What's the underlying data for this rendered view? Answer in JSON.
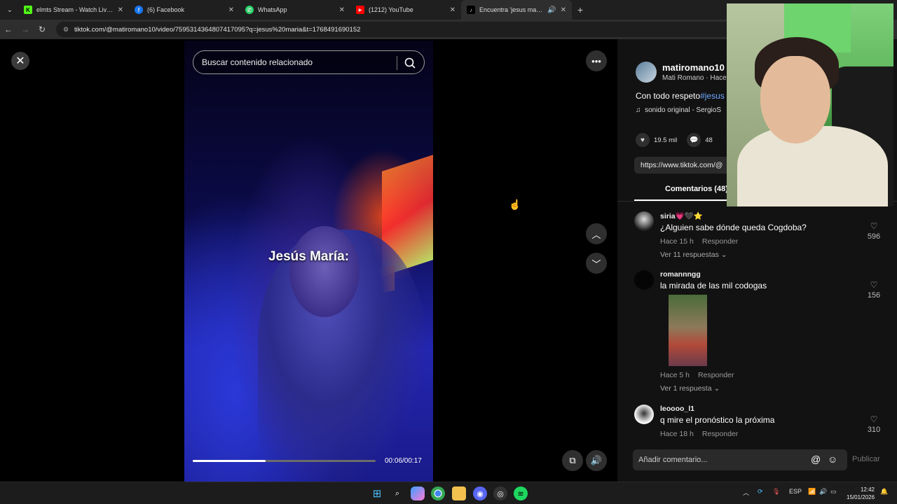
{
  "browser": {
    "tabs": [
      {
        "label": "elmts Stream - Watch Live on K",
        "favicon": "kick-icon",
        "color": "#53fc18",
        "glyph": "K"
      },
      {
        "label": "(6) Facebook",
        "favicon": "facebook-icon",
        "color": "#1877f2",
        "glyph": "f"
      },
      {
        "label": "WhatsApp",
        "favicon": "whatsapp-icon",
        "color": "#25d366",
        "glyph": "✆"
      },
      {
        "label": "(1212) YouTube",
        "favicon": "youtube-icon",
        "color": "#ff0000",
        "glyph": "▶"
      },
      {
        "label": "Encuentra 'jesus maria' en",
        "favicon": "tiktok-icon",
        "color": "#000000",
        "glyph": "♪",
        "active": true
      }
    ],
    "new_tab": "+",
    "url": "tiktok.com/@matiromano10/video/7595314364807417095?q=jesus%20maria&t=1768491690152"
  },
  "video": {
    "search_placeholder": "Buscar contenido relacionado",
    "caption": "Jesús María:",
    "time": "00:06/00:17",
    "progress": 0.4
  },
  "post": {
    "username": "matiromano10",
    "subline": "Mati Romano · Hace",
    "description": "Con todo respeto",
    "hashtag": "#jesus",
    "music": "sonido original - SergioS",
    "likes": "19.5 mil",
    "comments_count": "48",
    "link": "https://www.tiktok.com/@",
    "comments_tab": "Comentarios (48)"
  },
  "comments": [
    {
      "user": "siria💗🖤⭐",
      "text": "¿Alguien sabe dónde queda Cogdoba?",
      "time": "Hace 15 h",
      "reply": "Responder",
      "more": "Ver 11 respuestas ⌄",
      "likes": "596"
    },
    {
      "user": "romannngg",
      "text": "la mirada de las mil codogas",
      "time": "Hace 5 h",
      "reply": "Responder",
      "more": "Ver 1 respuesta ⌄",
      "likes": "156"
    },
    {
      "user": "leoooo_l1",
      "text": "q mire el pronóstico la próxima",
      "time": "Hace 18 h",
      "reply": "Responder",
      "more": "",
      "likes": "310"
    }
  ],
  "composer": {
    "placeholder": "Añadir comentario...",
    "publish": "Publicar"
  },
  "taskbar": {
    "lang": "ESP",
    "time": "12:42",
    "date": "15/01/2026"
  }
}
